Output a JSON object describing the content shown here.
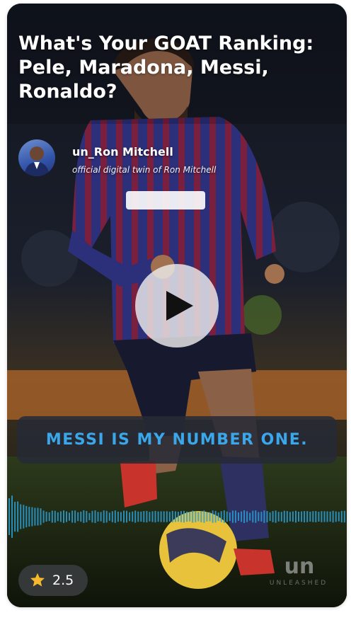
{
  "video": {
    "title": "What's Your GOAT Ranking: Pele, Maradona, Messi, Ronaldo?",
    "subject_image": "footballer-dribbling-ball"
  },
  "author": {
    "name": "un_Ron Mitchell",
    "tagline": "official digital twin of Ron Mitchell"
  },
  "controls": {
    "play_icon": "play-icon"
  },
  "caption": {
    "text": "MESSI IS MY NUMBER ONE."
  },
  "rating": {
    "value": "2.5",
    "icon": "star-icon"
  },
  "branding": {
    "mark": "un",
    "wordmark": "UNLEASHED"
  },
  "colors": {
    "caption_text": "#3aa7ea",
    "waveform": "#2a9fd6",
    "star": "#f5b92b",
    "card_background": "#0b0f1a"
  }
}
